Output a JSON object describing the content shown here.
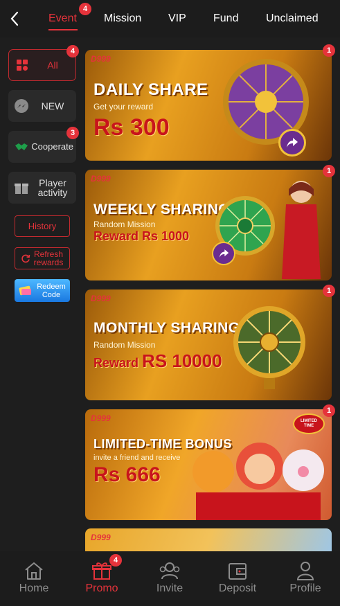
{
  "header": {
    "tabs": [
      {
        "label": "Event",
        "badge": "4",
        "active": true
      },
      {
        "label": "Mission"
      },
      {
        "label": "VIP"
      },
      {
        "label": "Fund"
      },
      {
        "label": "Unclaimed"
      }
    ]
  },
  "sidebar": {
    "items": [
      {
        "label": "All",
        "badge": "4",
        "icon": "grid-icon"
      },
      {
        "label": "NEW",
        "icon": "messenger-icon"
      },
      {
        "label": "Cooperate",
        "badge": "3",
        "icon": "handshake-icon"
      },
      {
        "label": "Player activity",
        "icon": "gift-icon"
      }
    ],
    "history_label": "History",
    "refresh_label": "Refresh rewards",
    "redeem_label": "Redeem Code"
  },
  "banners": [
    {
      "logo": "D999",
      "title": "DAILY SHARE",
      "subtitle": "Get your reward",
      "amount": "Rs 300",
      "badge": "1"
    },
    {
      "logo": "D999",
      "title": "WEEKLY SHARING",
      "subtitle": "Random Mission",
      "reward_prefix": "Reward",
      "amount": "Rs 1000",
      "badge": "1"
    },
    {
      "logo": "D999",
      "title": "MONTHLY SHARING",
      "subtitle": "Random Mission",
      "reward_prefix": "Reward",
      "amount": "RS 10000",
      "badge": "1"
    },
    {
      "logo": "D999",
      "title": "LIMITED-TIME BONUS",
      "subtitle": "invite a friend and receive",
      "amount": "Rs 666",
      "badge": "1",
      "tag": "LIMITED TIME"
    },
    {
      "logo": "D999"
    }
  ],
  "bottom_nav": {
    "items": [
      {
        "label": "Home",
        "icon": "home-icon"
      },
      {
        "label": "Promo",
        "icon": "gift-icon",
        "badge": "4",
        "active": true
      },
      {
        "label": "Invite",
        "icon": "users-icon"
      },
      {
        "label": "Deposit",
        "icon": "wallet-icon"
      },
      {
        "label": "Profile",
        "icon": "person-icon"
      }
    ]
  },
  "colors": {
    "accent": "#e5333b",
    "background": "#1e1e1e",
    "nav_inactive": "#8d8d8d"
  }
}
